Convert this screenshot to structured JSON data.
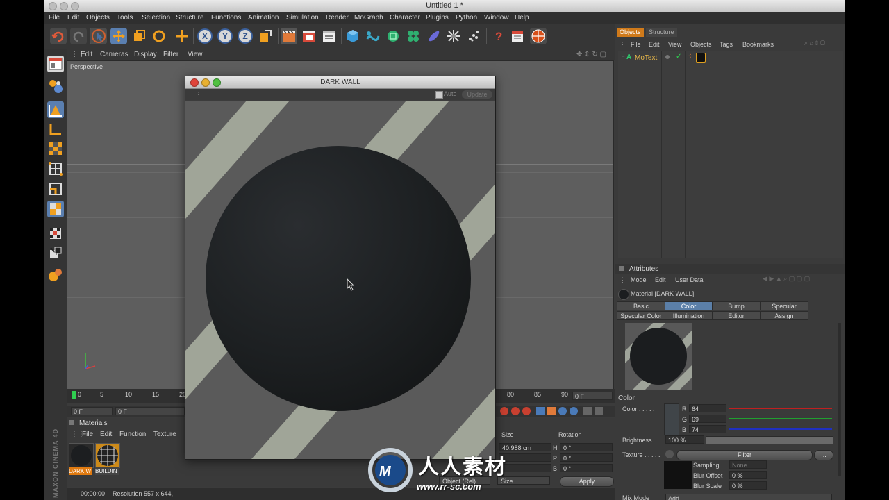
{
  "window": {
    "title": "Untitled 1 *"
  },
  "menubar": [
    "File",
    "Edit",
    "Objects",
    "Tools",
    "Selection",
    "Structure",
    "Functions",
    "Animation",
    "Simulation",
    "Render",
    "MoGraph",
    "Character",
    "Plugins",
    "Python",
    "Window",
    "Help"
  ],
  "toolbar": {
    "axis_x": "X",
    "axis_y": "Y",
    "axis_z": "Z"
  },
  "viewport": {
    "menu": [
      "Edit",
      "Cameras",
      "Display",
      "Filter",
      "View"
    ],
    "label": "Perspective"
  },
  "timeline": {
    "ticks": [
      "0",
      "5",
      "10",
      "15",
      "20",
      "80",
      "85",
      "90"
    ],
    "frame_left": "0 F",
    "frame_left2": "0 F",
    "frame_right": "0 F"
  },
  "materials": {
    "title": "Materials",
    "menu": [
      "File",
      "Edit",
      "Function",
      "Texture"
    ],
    "items": [
      "DARK W",
      "BUILDIN"
    ]
  },
  "coords": {
    "size_header": "Size",
    "rotation_header": "Rotation",
    "size_x": "40.988 cm",
    "rot_h_label": "H",
    "rot_h": "0 °",
    "rot_p_label": "P",
    "rot_p": "0 °",
    "rot_b_label": "B",
    "rot_b": "0 °",
    "mode_select": "Object (Rel)",
    "size_select": "Size",
    "apply": "Apply"
  },
  "status": {
    "time": "00:00:00",
    "text": "Resolution 557 x 644,"
  },
  "objects_panel": {
    "tabs": [
      "Objects",
      "Structure"
    ],
    "menu": [
      "File",
      "Edit",
      "View",
      "Objects",
      "Tags",
      "Bookmarks"
    ],
    "object_name": "MoText"
  },
  "attributes": {
    "title": "Attributes",
    "menu": [
      "Mode",
      "Edit",
      "User Data"
    ],
    "material_label": "Material [DARK WALL]",
    "tabs_row1": [
      "Basic",
      "Color",
      "Bump",
      "Specular"
    ],
    "tabs_row2": [
      "Specular Color",
      "Illumination",
      "Editor",
      "Assign"
    ],
    "active_tab": "Color",
    "section": "Color",
    "color_label": "Color . . . . .",
    "r_label": "R",
    "r": "64",
    "g_label": "G",
    "g": "69",
    "b_label": "B",
    "b": "74",
    "brightness_label": "Brightness . .",
    "brightness": "100 %",
    "texture_label": "Texture . . . . .",
    "filter_btn": "Filter",
    "more_btn": "...",
    "sampling_label": "Sampling",
    "sampling": "None",
    "blur_offset_label": "Blur Offset",
    "blur_offset": "0 %",
    "blur_scale_label": "Blur Scale",
    "blur_scale": "0 %",
    "mix_mode_label": "Mix Mode",
    "mix_mode": "Add"
  },
  "dialog": {
    "title": "DARK WALL",
    "auto_label": "Auto",
    "update_label": "Update"
  },
  "brand": "MAXON CINEMA 4D",
  "watermark": {
    "title": "人人素材",
    "url": "www.rr-sc.com"
  },
  "colors": {
    "accent": "#5b7fa8",
    "object_name": "#e8b84a",
    "material_r": "#404549"
  }
}
